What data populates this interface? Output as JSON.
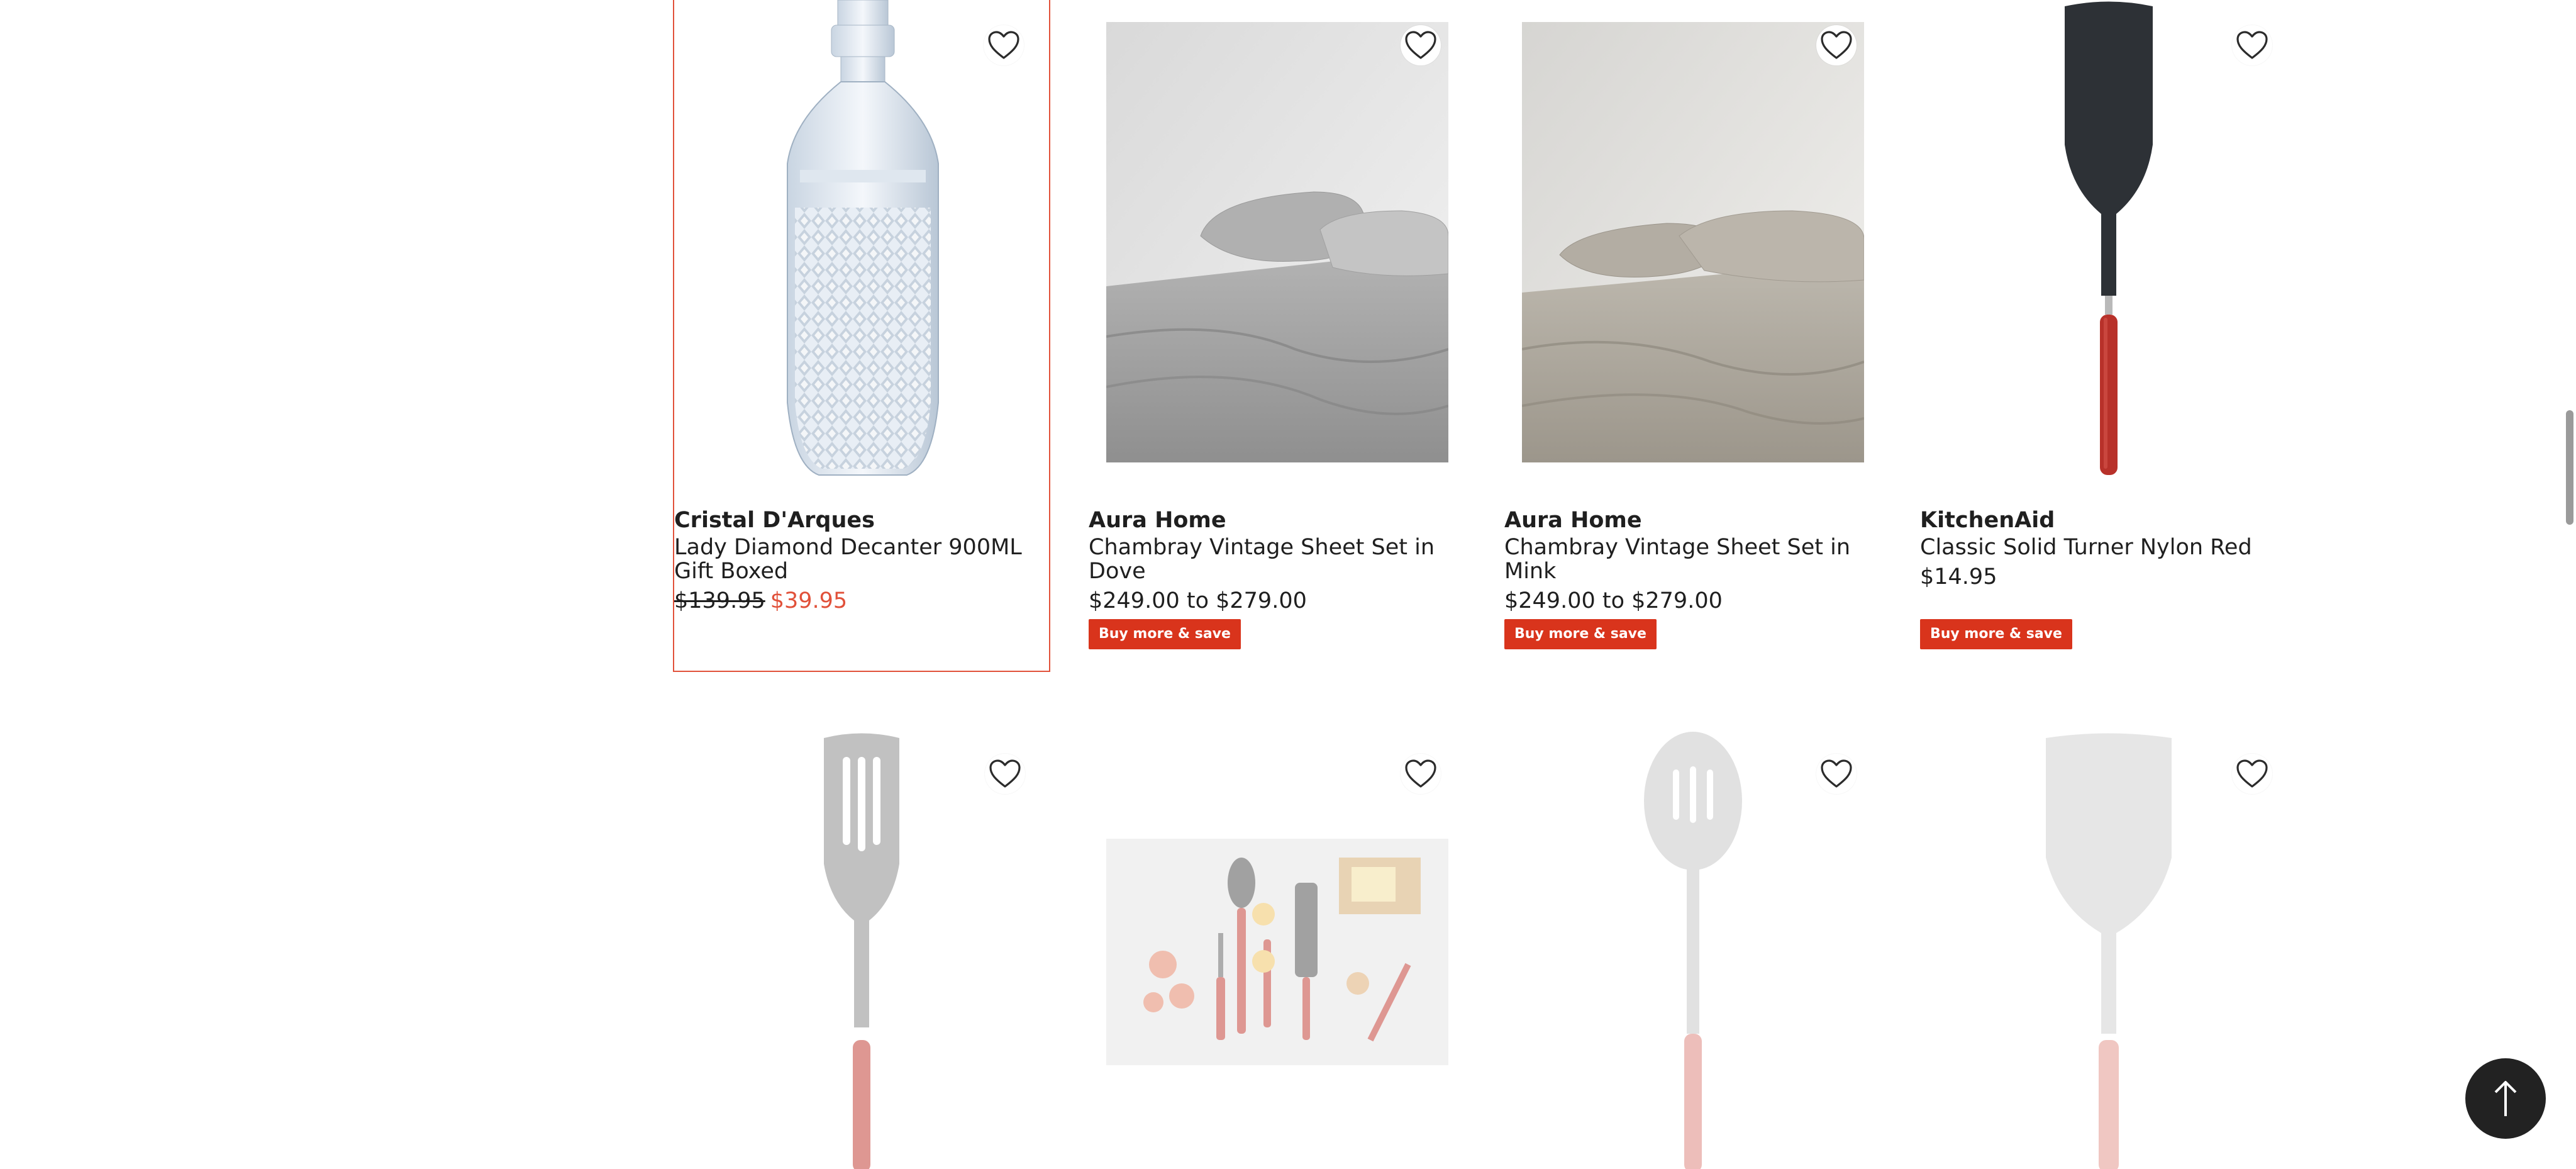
{
  "products_row1": [
    {
      "brand": "Cristal D'Arques",
      "name": "Lady Diamond Decanter 900ML Gift Boxed",
      "was_price": "$139.95",
      "now_price": "$39.95"
    },
    {
      "brand": "Aura Home",
      "name": "Chambray Vintage Sheet Set in Dove",
      "price": "$249.00 to $279.00",
      "badge": "Buy more & save"
    },
    {
      "brand": "Aura Home",
      "name": "Chambray Vintage Sheet Set in Mink",
      "price": "$249.00 to $279.00",
      "badge": "Buy more & save"
    },
    {
      "brand": "KitchenAid",
      "name": "Classic Solid Turner Nylon Red",
      "price": "$14.95",
      "badge": "Buy more & save"
    }
  ],
  "colors": {
    "accent": "#e1513a",
    "badge_bg": "#d9341c",
    "text": "#1f1f1f",
    "back_to_top_bg": "#222222"
  },
  "icons": {
    "favourite": "heart-outline-icon",
    "back_to_top": "arrow-up-icon"
  }
}
